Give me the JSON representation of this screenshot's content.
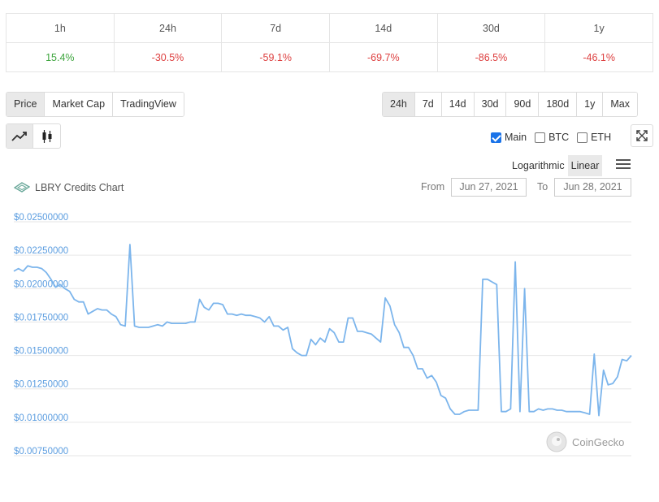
{
  "performance": {
    "periods": [
      "1h",
      "24h",
      "7d",
      "14d",
      "30d",
      "1y"
    ],
    "changes": [
      "15.4%",
      "-30.5%",
      "-59.1%",
      "-69.7%",
      "-86.5%",
      "-46.1%"
    ],
    "change_colors": [
      "#3ea53e",
      "#dd3f3f",
      "#dd3f3f",
      "#dd3f3f",
      "#dd3f3f",
      "#dd3f3f"
    ]
  },
  "view_tabs": {
    "items": [
      "Price",
      "Market Cap",
      "TradingView"
    ],
    "active": "Price"
  },
  "range_tabs": {
    "items": [
      "24h",
      "7d",
      "14d",
      "30d",
      "90d",
      "180d",
      "1y",
      "Max"
    ],
    "active": "24h"
  },
  "chart_types": {
    "items": [
      "line-chart-icon",
      "candlestick-icon"
    ],
    "active": "line-chart-icon"
  },
  "compare": {
    "items": [
      {
        "label": "Main",
        "checked": true
      },
      {
        "label": "BTC",
        "checked": false
      },
      {
        "label": "ETH",
        "checked": false
      }
    ]
  },
  "expand_icon": "expand-icon",
  "scale": {
    "logarithmic": "Logarithmic",
    "linear": "Linear",
    "active": "Linear"
  },
  "menu_icon": "hamburger-menu-icon",
  "chart_header": {
    "title": "LBRY Credits Chart",
    "from_label": "From",
    "from_value": "Jun 27, 2021",
    "to_label": "To",
    "to_value": "Jun 28, 2021"
  },
  "credit": "CoinGecko",
  "colors": {
    "line": "#7cb5ec",
    "axis_label": "#5b9de0",
    "positive": "#3ea53e",
    "negative": "#dd3f3f"
  },
  "chart_data": {
    "type": "line",
    "title": "LBRY Credits Chart",
    "xlabel": "",
    "ylabel": "",
    "ylim": [
      0.0075,
      0.025
    ],
    "yticks": [
      "$0.02500000",
      "$0.02250000",
      "$0.02000000",
      "$0.01750000",
      "$0.01500000",
      "$0.01250000",
      "$0.01000000",
      "$0.00750000"
    ],
    "ytick_values": [
      0.025,
      0.0225,
      0.02,
      0.0175,
      0.015,
      0.0125,
      0.01,
      0.0075
    ],
    "grid": true,
    "series": [
      {
        "values": [
          0.0213,
          0.0215,
          0.0213,
          0.0217,
          0.0216,
          0.0216,
          0.0215,
          0.0212,
          0.0207,
          0.0201,
          0.0203,
          0.02,
          0.0198,
          0.0192,
          0.019,
          0.019,
          0.0181,
          0.0183,
          0.0185,
          0.0184,
          0.0184,
          0.0181,
          0.0179,
          0.0173,
          0.0172,
          0.0233,
          0.0172,
          0.0171,
          0.0171,
          0.0171,
          0.0172,
          0.0173,
          0.0172,
          0.0175,
          0.0174,
          0.0174,
          0.0174,
          0.0174,
          0.0175,
          0.0175,
          0.0192,
          0.0186,
          0.0184,
          0.0189,
          0.0189,
          0.0188,
          0.0181,
          0.0181,
          0.018,
          0.0181,
          0.018,
          0.018,
          0.0179,
          0.0178,
          0.0175,
          0.0179,
          0.0172,
          0.0172,
          0.0169,
          0.0171,
          0.0155,
          0.0152,
          0.015,
          0.015,
          0.0162,
          0.0158,
          0.0163,
          0.016,
          0.017,
          0.0167,
          0.016,
          0.016,
          0.0178,
          0.0178,
          0.0168,
          0.0168,
          0.0167,
          0.0166,
          0.0163,
          0.016,
          0.0193,
          0.0187,
          0.0173,
          0.0167,
          0.0156,
          0.0156,
          0.015,
          0.014,
          0.014,
          0.0133,
          0.0135,
          0.013,
          0.012,
          0.0118,
          0.011,
          0.0106,
          0.0106,
          0.0108,
          0.0109,
          0.0109,
          0.0109,
          0.0207,
          0.0207,
          0.0205,
          0.0203,
          0.0108,
          0.0108,
          0.011,
          0.022,
          0.0108,
          0.02,
          0.0108,
          0.0108,
          0.011,
          0.0109,
          0.011,
          0.011,
          0.0109,
          0.0109,
          0.0108,
          0.0108,
          0.0108,
          0.0108,
          0.0107,
          0.0106,
          0.0151,
          0.0105,
          0.0139,
          0.0128,
          0.0129,
          0.0134,
          0.0147,
          0.0146,
          0.015
        ]
      }
    ]
  }
}
